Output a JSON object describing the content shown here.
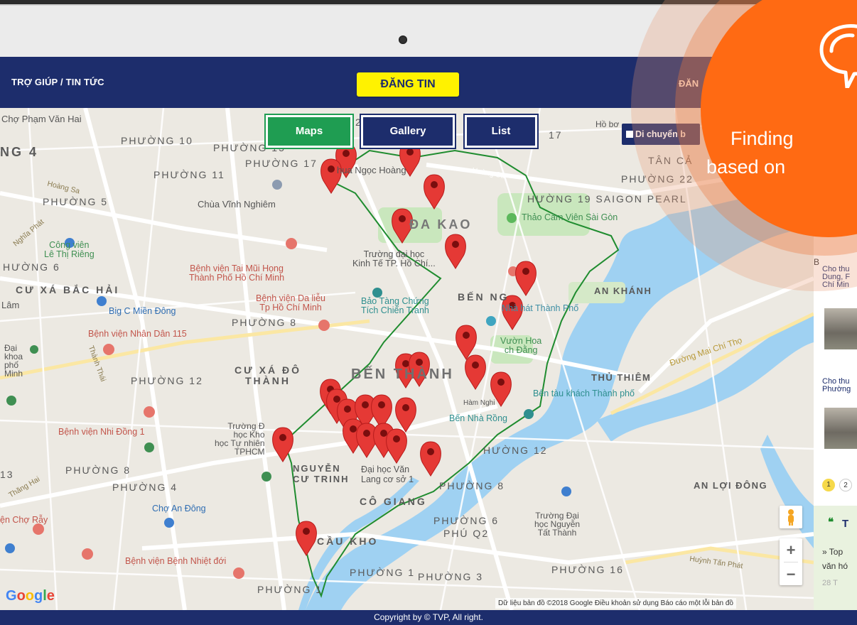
{
  "nav": {
    "left_label": "TRỢ GIÚP / TIN TỨC",
    "post_button": "ĐĂNG TIN",
    "right_label": "ĐĂN"
  },
  "tabs": [
    {
      "label": "Maps"
    },
    {
      "label": "Gallery"
    },
    {
      "label": "List"
    }
  ],
  "map": {
    "move_checkbox": "Di chuyển b",
    "labels": {
      "l01": "Chợ Phạm Văn Hai",
      "l02": "PHƯỜNG 10",
      "l03": "PHƯỜNG 11",
      "l04": "PHƯỜNG 5",
      "l05": "Chùa Vĩnh Nghiêm",
      "l06": "Công viên\nLê Thị Riêng",
      "l07": "HƯỜNG 6",
      "l08": "CƯ XÁ BẮC HẢI",
      "l09": "Big C Miền Đông",
      "l10": "Bệnh viện Nhân Dân 115",
      "l11": "PHƯỜNG 8",
      "l12": "Bệnh viện Tai Mũi Họng\nThành Phố Hồ Chí Minh",
      "l13": "Bệnh viện Da liễu\nTp Hồ Chí Minh",
      "l14": "Trường đại học\nKinh Tế TP. Hồ Chí...",
      "l15": "Bảo Tàng Chứng\nTích Chiến Tranh",
      "l16": "BẾN NG",
      "l17": "Nhà hát Thành Phố",
      "l18": "Vườn Hoa\nch Đằng",
      "l19": "PHƯỜNG 12",
      "l20": "CƯ XÁ ĐÔ\nTHÀNH",
      "l21": "BẾN THÀNH",
      "l22": "Trường Đ\nhọc Kho\nhọc Tự nhiên\nTPHCM",
      "l23": "Bệnh viện Nhi Đồng 1",
      "l24": "PHƯỜNG 8",
      "l25": "PHƯỜNG 4",
      "l26": "NGUYỄN\nCƯ TRINH",
      "l27": "Đại học Văn\nLang cơ sở 1",
      "l28": "Chợ An Đông",
      "l29": "CẦU KHO",
      "l30": "CÔ GIANG",
      "l31": "Bệnh viện Bệnh Nhiệt đới",
      "l32": "PHƯỜNG 1",
      "l33": "PHƯỜNG 1",
      "l34": "PHƯỜNG 3",
      "l35": "PHƯỜNG 6\nPHÚ Q2",
      "l36": "Trường Đại\nhọc Nguyễn\nTất Thành",
      "l37": "PHƯỜNG 16",
      "l38": "PHƯỜNG 8",
      "l39": "HƯỜNG 12",
      "l40": "Bến Nhà Rồng",
      "l41": "Hàm Nghi",
      "l42": "THỦ THIÊM",
      "l43": "Bến tàu khách Thành phố",
      "l44": "AN KHÁNH",
      "l45": "AN LỢI ĐÔNG",
      "l46": "HƯỜNG 19 SAIGON PEARL",
      "l47": "Thảo Cầm Viên Sài Gòn",
      "l48": "ĐA KAO",
      "l49": "PHƯỜNG 22",
      "l50": "TÂN CẢ",
      "l51": "hua Ngọc Hoàng",
      "l52": "PHƯỜNG 17",
      "l53": "PHƯỜNG 15",
      "l54": "NG 4",
      "l55": "Đường Mai Chí Thọ",
      "l56": "Hoàng Sa",
      "l57": "Hoàng Sa",
      "l58": "Huỳnh Tấn Phát",
      "l59": "Hồ bơ",
      "l60": "Lâm",
      "l61": "Đại\nkhoa\nphố\nMinh",
      "l62": "13",
      "l63": "Thăng Hai",
      "l64": "ện Chợ Rẫy",
      "l65": "Nghĩa Phát",
      "l66": "Thành Thái",
      "l67": "17",
      "l68": "2"
    },
    "google_logo": "Google",
    "attribution": "Dữ liệu bản đồ ©2018 Google  Điều khoản sử dụng  Báo cáo một lỗi bản đồ",
    "zoom_in": "+",
    "zoom_out": "−"
  },
  "side": {
    "item1": "Cho thu\nDung, F\nChí Min",
    "item2": "Cho thu\nPhường",
    "page1": "1",
    "page2": "2",
    "box_title": "T",
    "box_line1": "» Top",
    "box_line2": "văn hó",
    "box_date": "28 T",
    "b_char": "B"
  },
  "promo": {
    "line1": "Finding",
    "line2": "based on"
  },
  "footer": {
    "copyright": "Copyright by © TVP, All right."
  },
  "colors": {
    "navy": "#1d2d6c",
    "yellow": "#fff200",
    "green": "#1f9d52",
    "orange": "#ff6a13",
    "pin": "#e53935"
  }
}
